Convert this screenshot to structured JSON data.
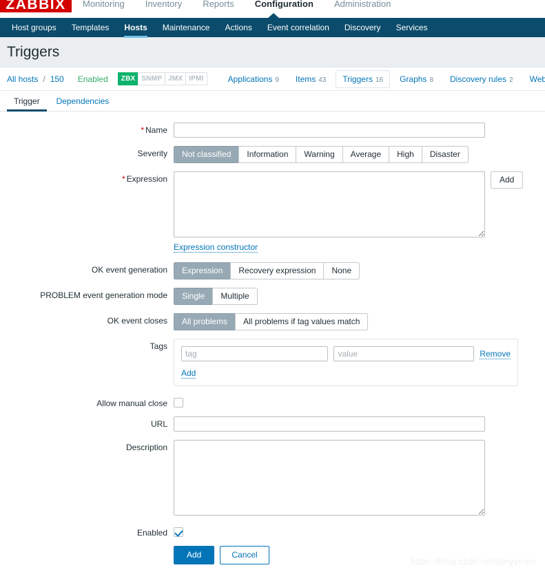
{
  "topbar": {
    "logo": "ZABBIX",
    "menu": [
      {
        "label": "Monitoring",
        "active": false
      },
      {
        "label": "Inventory",
        "active": false
      },
      {
        "label": "Reports",
        "active": false
      },
      {
        "label": "Configuration",
        "active": true
      },
      {
        "label": "Administration",
        "active": false
      }
    ]
  },
  "subnav": {
    "items": [
      {
        "label": "Host groups",
        "active": false
      },
      {
        "label": "Templates",
        "active": false
      },
      {
        "label": "Hosts",
        "active": true
      },
      {
        "label": "Maintenance",
        "active": false
      },
      {
        "label": "Actions",
        "active": false
      },
      {
        "label": "Event correlation",
        "active": false
      },
      {
        "label": "Discovery",
        "active": false
      },
      {
        "label": "Services",
        "active": false
      }
    ]
  },
  "page": {
    "title": "Triggers",
    "watermark": "https://blog.csdn.net/tanyyinyu"
  },
  "breadcrumb": {
    "all_hosts": "All hosts",
    "separator": "/",
    "host_count": "150",
    "status": "Enabled",
    "interfaces": [
      {
        "label": "ZBX",
        "enabled": true
      },
      {
        "label": "SNMP",
        "enabled": false
      },
      {
        "label": "JMX",
        "enabled": false
      },
      {
        "label": "IPMI",
        "enabled": false
      }
    ],
    "tabs": [
      {
        "label": "Applications",
        "count": "9",
        "selected": false
      },
      {
        "label": "Items",
        "count": "43",
        "selected": false
      },
      {
        "label": "Triggers",
        "count": "16",
        "selected": true
      },
      {
        "label": "Graphs",
        "count": "8",
        "selected": false
      },
      {
        "label": "Discovery rules",
        "count": "2",
        "selected": false
      },
      {
        "label": "Web scenarios",
        "count": "",
        "selected": false
      }
    ]
  },
  "form_tabs": [
    {
      "label": "Trigger",
      "active": true
    },
    {
      "label": "Dependencies",
      "active": false
    }
  ],
  "form": {
    "name": {
      "label": "Name",
      "required": true,
      "value": "",
      "placeholder": ""
    },
    "severity": {
      "label": "Severity",
      "options": [
        "Not classified",
        "Information",
        "Warning",
        "Average",
        "High",
        "Disaster"
      ],
      "selected": "Not classified"
    },
    "expression": {
      "label": "Expression",
      "required": true,
      "value": "",
      "add_button": "Add",
      "constructor_link": "Expression constructor"
    },
    "ok_event_generation": {
      "label": "OK event generation",
      "options": [
        "Expression",
        "Recovery expression",
        "None"
      ],
      "selected": "Expression"
    },
    "problem_event_generation_mode": {
      "label": "PROBLEM event generation mode",
      "options": [
        "Single",
        "Multiple"
      ],
      "selected": "Single"
    },
    "ok_event_closes": {
      "label": "OK event closes",
      "options": [
        "All problems",
        "All problems if tag values match"
      ],
      "selected": "All problems"
    },
    "tags": {
      "label": "Tags",
      "rows": [
        {
          "tag_value": "",
          "tag_placeholder": "tag",
          "value_value": "",
          "value_placeholder": "value",
          "remove_label": "Remove"
        }
      ],
      "add_label": "Add"
    },
    "allow_manual_close": {
      "label": "Allow manual close",
      "checked": false
    },
    "url": {
      "label": "URL",
      "value": "",
      "placeholder": ""
    },
    "description": {
      "label": "Description",
      "value": "",
      "placeholder": ""
    },
    "enabled": {
      "label": "Enabled",
      "checked": true
    },
    "actions": {
      "submit": "Add",
      "cancel": "Cancel"
    }
  }
}
